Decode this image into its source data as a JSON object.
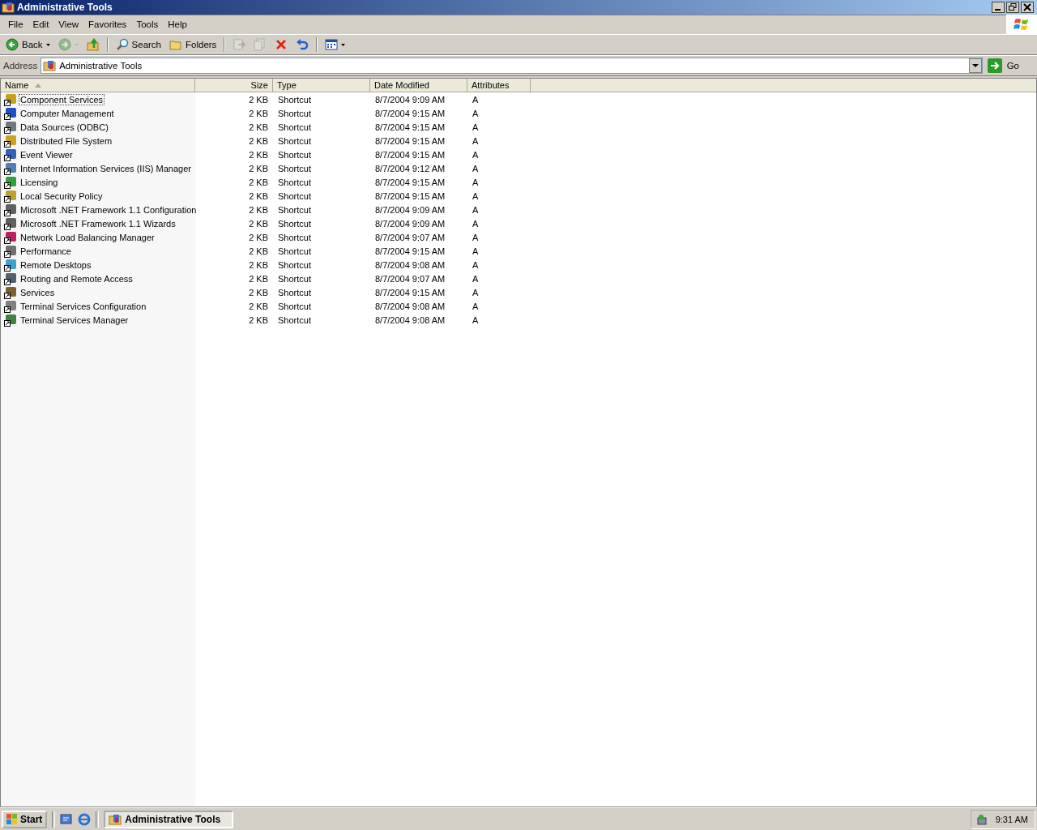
{
  "window": {
    "title": "Administrative Tools"
  },
  "menu": [
    "File",
    "Edit",
    "View",
    "Favorites",
    "Tools",
    "Help"
  ],
  "toolbar": [
    {
      "kind": "back",
      "label": "Back",
      "disabled": false
    },
    {
      "kind": "forward",
      "disabled": true
    },
    {
      "kind": "up",
      "disabled": false
    },
    {
      "kind": "search",
      "label": "Search",
      "disabled": false
    },
    {
      "kind": "folders",
      "label": "Folders",
      "disabled": false
    },
    {
      "kind": "move",
      "disabled": true
    },
    {
      "kind": "copy",
      "disabled": true
    },
    {
      "kind": "delete",
      "disabled": false
    },
    {
      "kind": "undo",
      "disabled": false
    },
    {
      "kind": "views",
      "disabled": false
    }
  ],
  "address": {
    "label": "Address",
    "value": "Administrative Tools",
    "go": "Go"
  },
  "columns": [
    {
      "label": "Name",
      "sorted": true
    },
    {
      "label": "Size",
      "sorted": false
    },
    {
      "label": "Type",
      "sorted": false
    },
    {
      "label": "Date Modified",
      "sorted": false
    },
    {
      "label": "Attributes",
      "sorted": false
    }
  ],
  "rows": [
    {
      "name": "Component Services",
      "size": "2 KB",
      "type": "Shortcut",
      "date": "8/7/2004 9:09 AM",
      "attributes": "A",
      "focused": true
    },
    {
      "name": "Computer Management",
      "size": "2 KB",
      "type": "Shortcut",
      "date": "8/7/2004 9:15 AM",
      "attributes": "A",
      "focused": false
    },
    {
      "name": "Data Sources (ODBC)",
      "size": "2 KB",
      "type": "Shortcut",
      "date": "8/7/2004 9:15 AM",
      "attributes": "A",
      "focused": false
    },
    {
      "name": "Distributed File System",
      "size": "2 KB",
      "type": "Shortcut",
      "date": "8/7/2004 9:15 AM",
      "attributes": "A",
      "focused": false
    },
    {
      "name": "Event Viewer",
      "size": "2 KB",
      "type": "Shortcut",
      "date": "8/7/2004 9:15 AM",
      "attributes": "A",
      "focused": false
    },
    {
      "name": "Internet Information Services (IIS) Manager",
      "size": "2 KB",
      "type": "Shortcut",
      "date": "8/7/2004 9:12 AM",
      "attributes": "A",
      "focused": false
    },
    {
      "name": "Licensing",
      "size": "2 KB",
      "type": "Shortcut",
      "date": "8/7/2004 9:15 AM",
      "attributes": "A",
      "focused": false
    },
    {
      "name": "Local Security Policy",
      "size": "2 KB",
      "type": "Shortcut",
      "date": "8/7/2004 9:15 AM",
      "attributes": "A",
      "focused": false
    },
    {
      "name": "Microsoft .NET Framework 1.1 Configuration",
      "size": "2 KB",
      "type": "Shortcut",
      "date": "8/7/2004 9:09 AM",
      "attributes": "A",
      "focused": false
    },
    {
      "name": "Microsoft .NET Framework 1.1 Wizards",
      "size": "2 KB",
      "type": "Shortcut",
      "date": "8/7/2004 9:09 AM",
      "attributes": "A",
      "focused": false
    },
    {
      "name": "Network Load Balancing Manager",
      "size": "2 KB",
      "type": "Shortcut",
      "date": "8/7/2004 9:07 AM",
      "attributes": "A",
      "focused": false
    },
    {
      "name": "Performance",
      "size": "2 KB",
      "type": "Shortcut",
      "date": "8/7/2004 9:15 AM",
      "attributes": "A",
      "focused": false
    },
    {
      "name": "Remote Desktops",
      "size": "2 KB",
      "type": "Shortcut",
      "date": "8/7/2004 9:08 AM",
      "attributes": "A",
      "focused": false
    },
    {
      "name": "Routing and Remote Access",
      "size": "2 KB",
      "type": "Shortcut",
      "date": "8/7/2004 9:07 AM",
      "attributes": "A",
      "focused": false
    },
    {
      "name": "Services",
      "size": "2 KB",
      "type": "Shortcut",
      "date": "8/7/2004 9:15 AM",
      "attributes": "A",
      "focused": false
    },
    {
      "name": "Terminal Services Configuration",
      "size": "2 KB",
      "type": "Shortcut",
      "date": "8/7/2004 9:08 AM",
      "attributes": "A",
      "focused": false
    },
    {
      "name": "Terminal Services Manager",
      "size": "2 KB",
      "type": "Shortcut",
      "date": "8/7/2004 9:08 AM",
      "attributes": "A",
      "focused": false
    }
  ],
  "taskbar": {
    "start": "Start",
    "tasks": [
      {
        "label": "Administrative Tools",
        "selected": true
      }
    ],
    "clock": "9:31 AM"
  }
}
